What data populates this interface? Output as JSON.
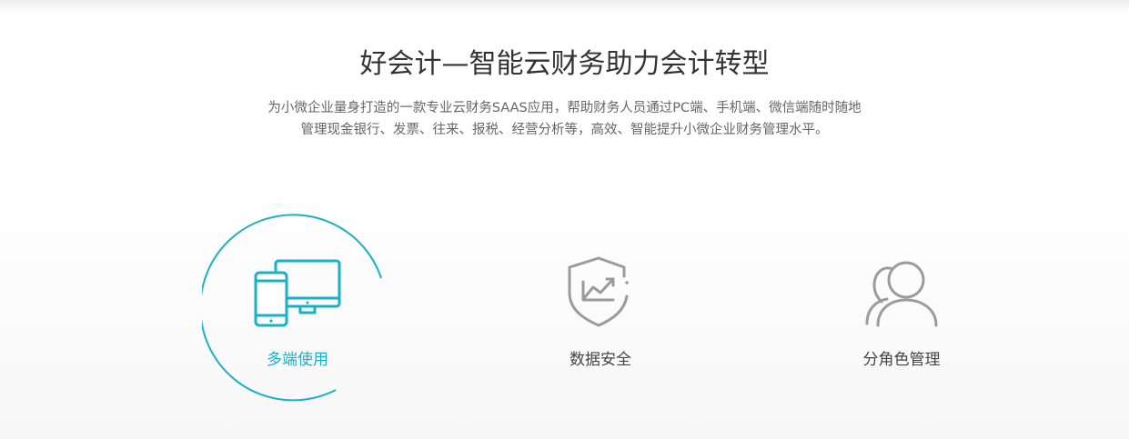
{
  "hero": {
    "title": "好会计—智能云财务助力会计转型",
    "subtitle_line1": "为小微企业量身打造的一款专业云财务SAAS应用，帮助财务人员通过PC端、手机端、微信端随时随地",
    "subtitle_line2": "管理现金银行、发票、往来、报税、经营分析等，高效、智能提升小微企业财务管理水平。"
  },
  "features": [
    {
      "label": "多端使用",
      "icon": "multi-device-icon",
      "active": true
    },
    {
      "label": "数据安全",
      "icon": "data-security-shield-icon",
      "active": false
    },
    {
      "label": "分角色管理",
      "icon": "role-management-user-icon",
      "active": false
    }
  ],
  "colors": {
    "accent": "#1ab1c5",
    "icon_gray": "#9b9b9b",
    "title": "#333333",
    "text": "#666666"
  }
}
